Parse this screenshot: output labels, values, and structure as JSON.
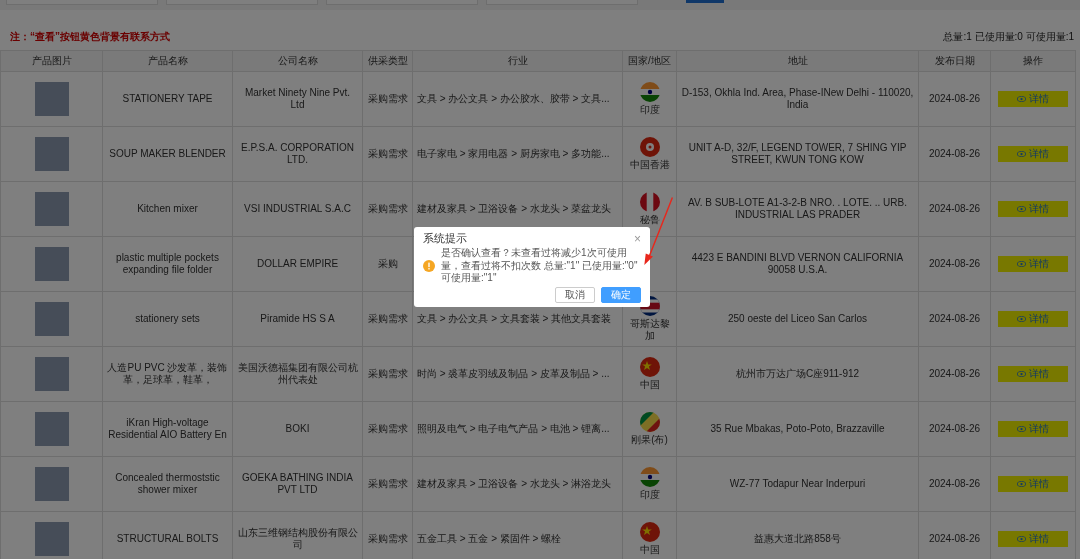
{
  "note": "注：“查看”按钮黄色背景有联系方式",
  "quota_summary": "总量:1 已使用量:0 可使用量:1",
  "table": {
    "columns": [
      "产品图片",
      "产品名称",
      "公司名称",
      "供采类型",
      "行业",
      "国家/地区",
      "地址",
      "发布日期",
      "操作"
    ],
    "rows": [
      {
        "product": "STATIONERY TAPE",
        "company": "Market Ninety Nine Pvt. Ltd",
        "supply_type": "采购需求",
        "industry": "文具 > 办公文具 > 办公胶水、胶带 > 文具...",
        "country": {
          "kind": "india",
          "name": "印度"
        },
        "address": "D-153, Okhla Ind. Area, Phase-INew Delhi - 110020, India",
        "date": "2024-08-26",
        "action": "详情"
      },
      {
        "product": "SOUP MAKER BLENDER",
        "company": "E.P.S.A. CORPORATION LTD.",
        "supply_type": "采购需求",
        "industry": "电子家电 > 家用电器 > 厨房家电 > 多功能...",
        "country": {
          "kind": "hongkong",
          "name": "中国香港"
        },
        "address": "UNIT A-D, 32/F, LEGEND TOWER, 7 SHING YIP STREET, KWUN TONG KOW",
        "date": "2024-08-26",
        "action": "详情"
      },
      {
        "product": "Kitchen mixer",
        "company": "VSI INDUSTRIAL S.A.C",
        "supply_type": "采购需求",
        "industry": "建材及家具 > 卫浴设备 > 水龙头 > 菜盆龙头",
        "country": {
          "kind": "peru",
          "name": "秘鲁"
        },
        "address": "AV. B SUB-LOTE A1-3-2-B NRO. . LOTE. .. URB. INDUSTRIAL LAS PRADER",
        "date": "2024-08-26",
        "action": "详情"
      },
      {
        "product": "plastic multiple pockets expanding file folder",
        "company": "DOLLAR EMPIRE",
        "supply_type": "采购",
        "address": "4423 E BANDINI BLVD VERNON CALIFORNIA 90058 U.S.A.",
        "date": "2024-08-26",
        "action": "详情"
      },
      {
        "product": "stationery sets",
        "company": "Piramide HS S A",
        "supply_type": "采购需求",
        "industry": "文具 > 办公文具 > 文具套装 > 其他文具套装",
        "country": {
          "kind": "costarica",
          "name": "哥斯达黎加"
        },
        "address": "250 oeste del Liceo San Carlos",
        "date": "2024-08-26",
        "action": "详情"
      },
      {
        "product": "人造PU PVC 沙发革，装饰革，足球革，鞋革，",
        "company": "美国沃德福集团有限公司杭州代表处",
        "supply_type": "采购需求",
        "industry": "时尚 > 裘革皮羽绒及制品 > 皮革及制品 > ...",
        "country": {
          "kind": "china",
          "name": "中国"
        },
        "address": "杭州市万达广场C座911-912",
        "date": "2024-08-26",
        "action": "详情"
      },
      {
        "product": "iKran High-voltage Residential AIO Battery En",
        "company": "BOKI",
        "supply_type": "采购需求",
        "industry": "照明及电气 > 电子电气产品 > 电池 > 锂离...",
        "country": {
          "kind": "congo",
          "name": "刚果(布)"
        },
        "address": "35 Rue Mbakas, Poto-Poto, Brazzaville",
        "date": "2024-08-26",
        "action": "详情"
      },
      {
        "product": "Concealed thermoststic shower mixer",
        "company": "GOEKA BATHING INDIA PVT LTD",
        "supply_type": "采购需求",
        "industry": "建材及家具 > 卫浴设备 > 水龙头 > 淋浴龙头",
        "country": {
          "kind": "india",
          "name": "印度"
        },
        "address": "WZ-77 Todapur Near Inderpuri",
        "date": "2024-08-26",
        "action": "详情"
      },
      {
        "product": "STRUCTURAL BOLTS",
        "company": "山东三维钢结构股份有限公司",
        "supply_type": "采购需求",
        "industry": "五金工具 > 五金 > 紧固件 > 螺栓",
        "country": {
          "kind": "china",
          "name": "中国"
        },
        "address": "益惠大道北路858号",
        "date": "2024-08-26",
        "action": "详情"
      }
    ]
  },
  "dialog": {
    "title": "系统提示",
    "close": "×",
    "message": "是否确认查看？未查看过将减少1次可使用量，查看过将不扣次数 总量:\"1\" 已使用量:\"0\" 可使用量:\"1\"",
    "buttons": [
      {
        "label": "取消",
        "kind": "secondary"
      },
      {
        "label": "确定",
        "kind": "primary"
      }
    ]
  }
}
